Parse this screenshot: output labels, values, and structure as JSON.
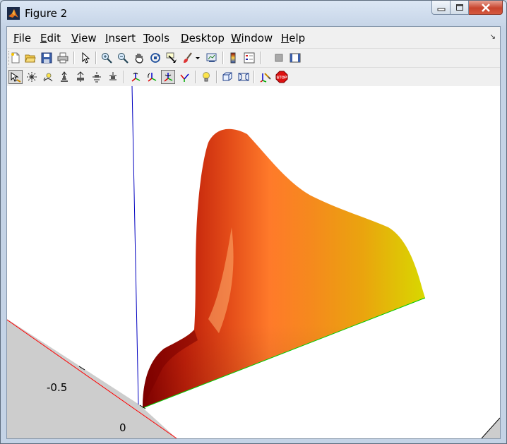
{
  "window": {
    "title": "Figure 2"
  },
  "menu": {
    "file": {
      "u": "F",
      "rest": "ile"
    },
    "edit": {
      "u": "E",
      "rest": "dit"
    },
    "view": {
      "u": "V",
      "rest": "iew"
    },
    "insert": {
      "u": "I",
      "rest": "nsert"
    },
    "tools": {
      "u": "T",
      "rest": "ools"
    },
    "desktop": {
      "u": "D",
      "rest": "esktop"
    },
    "window": {
      "u": "W",
      "rest": "indow"
    },
    "help": {
      "u": "H",
      "rest": "elp"
    }
  },
  "toolbar1": [
    "new-figure-icon",
    "open-file-icon",
    "save-icon",
    "print-icon",
    "edit-plot-icon",
    "zoom-in-icon",
    "zoom-out-icon",
    "pan-icon",
    "rotate-3d-icon",
    "data-cursor-icon",
    "brush-icon",
    "brush-dropdown-icon",
    "link-plot-icon",
    "insert-colorbar-icon",
    "insert-legend-icon",
    "hide-plot-tools-icon",
    "show-plot-tools-icon"
  ],
  "toolbar2": [
    "select-camera-icon",
    "orbit-camera-icon",
    "orbit-light-icon",
    "pan-tilt-camera-icon",
    "move-camera-icon",
    "zoom-camera-icon",
    "roll-camera-icon",
    "x-principal-axis-icon",
    "y-principal-axis-icon",
    "z-principal-axis-icon",
    "no-principal-axis-icon",
    "toggle-light-icon",
    "orthographic-projection-icon",
    "perspective-projection-icon",
    "reset-camera-icon",
    "stop-camera-icon"
  ],
  "stop_text": "STOP",
  "axes": {
    "tick_labels": [
      "-0.5",
      "0"
    ]
  },
  "colors": {
    "x_axis": "#ff0000",
    "y_axis": "#00cc00",
    "z_axis": "#0000c0",
    "floor": "#cdcdcd"
  }
}
